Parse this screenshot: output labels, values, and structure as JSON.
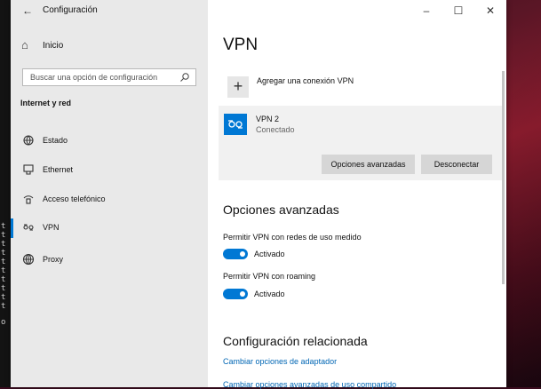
{
  "window": {
    "title": "Configuración",
    "back_icon": "arrow-left-icon",
    "controls": {
      "minimize": "–",
      "maximize": "☐",
      "close": "✕"
    }
  },
  "desktop": {
    "terminal_chars": [
      "t",
      "t",
      "t",
      "t",
      "t",
      "t",
      "t",
      "t",
      "t",
      "t",
      "o"
    ]
  },
  "sidebar": {
    "home_label": "Inicio",
    "search_placeholder": "Buscar una opción de configuración",
    "section_heading": "Internet y red",
    "items": [
      {
        "label": "Estado",
        "icon": "globe-status-icon"
      },
      {
        "label": "Ethernet",
        "icon": "ethernet-icon"
      },
      {
        "label": "Acceso telefónico",
        "icon": "dialup-icon"
      },
      {
        "label": "VPN",
        "icon": "vpn-icon",
        "active": true
      },
      {
        "label": "Proxy",
        "icon": "globe-icon"
      }
    ],
    "active_color": "#0078d4"
  },
  "main": {
    "page_title": "VPN",
    "add_vpn_label": "Agregar una conexión VPN",
    "vpn_connection": {
      "name": "VPN 2",
      "status": "Conectado",
      "icon": "vpn-icon"
    },
    "buttons": {
      "advanced": "Opciones avanzadas",
      "disconnect": "Desconectar"
    },
    "advanced_options": {
      "heading": "Opciones avanzadas",
      "settings": [
        {
          "label": "Permitir VPN con redes de uso medido",
          "state": "Activado",
          "on": true
        },
        {
          "label": "Permitir VPN con roaming",
          "state": "Activado",
          "on": true
        }
      ]
    },
    "related": {
      "heading": "Configuración relacionada",
      "links": [
        "Cambiar opciones de adaptador",
        "Cambiar opciones avanzadas de uso compartido"
      ]
    }
  },
  "colors": {
    "accent": "#0078d4",
    "link": "#0066b4",
    "sidebar_bg": "#e9e9e9",
    "card_bg": "#f1f1f1"
  }
}
